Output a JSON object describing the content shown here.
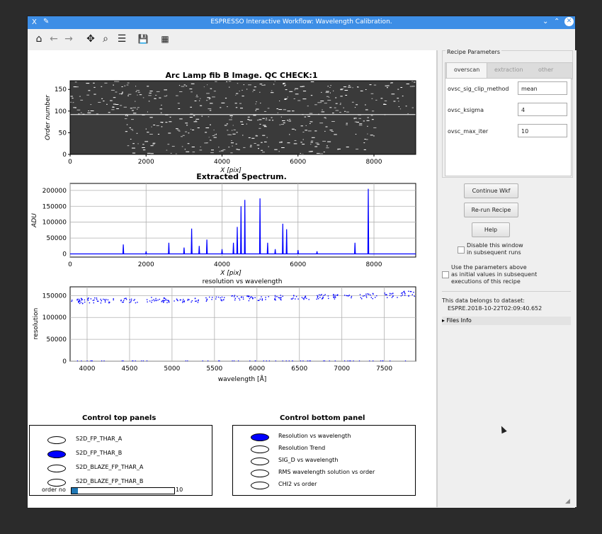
{
  "window": {
    "title": "ESPRESSO Interactive Workflow: Wavelength Calibration.",
    "app_glyph": "X",
    "pin_glyph": "✎",
    "controls": [
      "⌄",
      "⌃",
      "✕"
    ]
  },
  "toolbar": {
    "home": "⌂",
    "back": "←",
    "forward": "→",
    "pan": "✥",
    "zoom": "⌕",
    "configure": "☰",
    "save": "💾",
    "edit": "▦"
  },
  "colors": {
    "titlebar": "#3d8ee6",
    "series": "#0000ff",
    "image_bg": "#444444"
  },
  "plots": {
    "top": {
      "title": "Arc Lamp fib B Image. QC CHECK:1",
      "xlabel": "X [pix]",
      "ylabel": "Order number",
      "xticks": [
        "0",
        "2000",
        "4000",
        "6000",
        "8000"
      ],
      "yticks": [
        "0",
        "50",
        "100",
        "150"
      ]
    },
    "middle": {
      "title": "Extracted Spectrum.",
      "xlabel": "X [pix]",
      "ylabel": "ADU",
      "xticks": [
        "0",
        "2000",
        "4000",
        "6000",
        "8000"
      ],
      "yticks": [
        "0",
        "50000",
        "100000",
        "150000",
        "200000"
      ]
    },
    "bottom": {
      "title": "resolution vs wavelength",
      "xlabel": "wavelength [Å]",
      "ylabel": "resolution",
      "xticks": [
        "4000",
        "4500",
        "5000",
        "5500",
        "6000",
        "6500",
        "7000",
        "7500"
      ],
      "yticks": [
        "0",
        "50000",
        "100000",
        "150000"
      ]
    }
  },
  "chart_data": [
    {
      "type": "heatmap",
      "title": "Arc Lamp fib B Image. QC CHECK:1",
      "xlabel": "X [pix]",
      "ylabel": "Order number",
      "xlim": [
        0,
        9100
      ],
      "ylim": [
        0,
        170
      ]
    },
    {
      "type": "line",
      "title": "Extracted Spectrum.",
      "xlabel": "X [pix]",
      "ylabel": "ADU",
      "xlim": [
        0,
        9100
      ],
      "ylim": [
        -10000,
        222000
      ],
      "x": [
        1400,
        2000,
        2600,
        3000,
        3200,
        3400,
        3600,
        4000,
        4300,
        4400,
        4500,
        4600,
        5000,
        5200,
        5400,
        5600,
        5700,
        6000,
        6500,
        7500,
        7850
      ],
      "values": [
        30000,
        8000,
        35000,
        20000,
        80000,
        25000,
        45000,
        15000,
        35000,
        85000,
        150000,
        170000,
        175000,
        35000,
        15000,
        95000,
        78000,
        12000,
        8000,
        35000,
        205000
      ]
    },
    {
      "type": "scatter",
      "title": "resolution vs wavelength",
      "xlabel": "wavelength [Å]",
      "ylabel": "resolution",
      "xlim": [
        3800,
        7870
      ],
      "ylim": [
        0,
        170000
      ],
      "series": [
        {
          "x": [
            3850,
            4000,
            4200,
            4500,
            4800,
            5000,
            5200,
            5500,
            5800,
            6000,
            6200,
            6500,
            6800,
            7000,
            7300,
            7600,
            7800
          ],
          "values": [
            138000,
            140000,
            139000,
            140000,
            141000,
            140000,
            141000,
            144000,
            146000,
            145000,
            146000,
            147000,
            148000,
            149000,
            150000,
            152000,
            155000
          ]
        }
      ]
    }
  ],
  "params": {
    "group_title": "Recipe Parameters",
    "tabs": [
      "overscan",
      "extraction",
      "other"
    ],
    "rows": [
      {
        "name": "ovsc_sig_clip_method",
        "value": "mean"
      },
      {
        "name": "ovsc_ksigma",
        "value": "4"
      },
      {
        "name": "ovsc_max_iter",
        "value": "10"
      }
    ]
  },
  "buttons": {
    "continue": "Continue Wkf",
    "rerun": "Re-run Recipe",
    "help": "Help"
  },
  "options": {
    "disable_line1": "Disable this window",
    "disable_line2": "in subsequent runs",
    "use_line1": "Use the parameters above",
    "use_line2": "as initial values in subsequent",
    "use_line3": "executions of this recipe"
  },
  "dataset": {
    "label": "This data belongs to dataset:",
    "name": "ESPRE.2018-10-22T02:09:40.652"
  },
  "files_info": "▸ Files Info",
  "control_top": {
    "title": "Control top panels",
    "items": [
      "S2D_FP_THAR_A",
      "S2D_FP_THAR_B",
      "S2D_BLAZE_FP_THAR_A",
      "S2D_BLAZE_FP_THAR_B"
    ],
    "selected": "S2D_FP_THAR_B",
    "slider_label": "order no",
    "slider_value": "10",
    "slider_fraction": 0.06
  },
  "control_bottom": {
    "title": "Control bottom panel",
    "items": [
      "Resolution vs wavelength",
      "Resolution Trend",
      "SIG_D vs wavelength",
      "RMS wavelength solution vs order",
      "CHI2 vs order"
    ],
    "selected": "Resolution vs wavelength"
  }
}
